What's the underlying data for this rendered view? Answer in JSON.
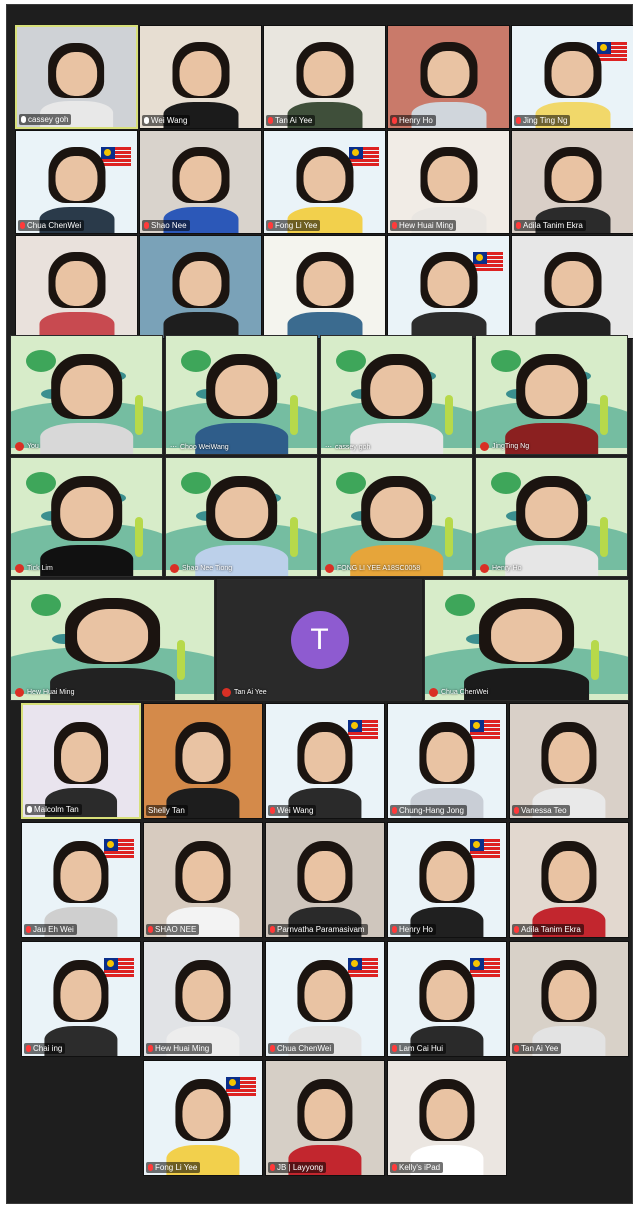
{
  "zoom_top": {
    "tiles": [
      {
        "name": "cassey goh",
        "active": true,
        "mic": "white",
        "bg": "#cfd2d6",
        "shirt": "#e8e8e8"
      },
      {
        "name": "Wei Wang",
        "active": false,
        "mic": "white",
        "bg": "#e7ded2",
        "shirt": "#1b1b1b"
      },
      {
        "name": "Tan Ai Yee",
        "active": false,
        "mic": "red",
        "bg": "#e9e6df",
        "shirt": "#3f4f3a"
      },
      {
        "name": "Henry Ho",
        "active": false,
        "mic": "red",
        "bg": "#c97a6a",
        "shirt": "#d0d6dc"
      },
      {
        "name": "Jing Ting Ng",
        "active": false,
        "mic": "red",
        "bg": "#eaf3f8",
        "shirt": "#f1d86a"
      },
      {
        "name": "Chua ChenWei",
        "active": false,
        "mic": "red",
        "bg": "#eaf3f8",
        "shirt": "#2a3a4a"
      },
      {
        "name": "Shao Nee",
        "active": false,
        "mic": "red",
        "bg": "#d9d3cc",
        "shirt": "#2c58b8"
      },
      {
        "name": "Fong Li Yee",
        "active": false,
        "mic": "red",
        "bg": "#eaf3f8",
        "shirt": "#f2d04c"
      },
      {
        "name": "Hew Huai Ming",
        "active": false,
        "mic": "red",
        "bg": "#f1ece6",
        "shirt": "#e9e6e2"
      },
      {
        "name": "Adila Tanim Ekra",
        "active": false,
        "mic": "red",
        "bg": "#d9cfc7",
        "shirt": "#2b2b2b"
      },
      {
        "name": "",
        "active": false,
        "mic": "",
        "bg": "#e9e1dc",
        "shirt": "#c84a50"
      },
      {
        "name": "",
        "active": false,
        "mic": "",
        "bg": "#7aa2b8",
        "shirt": "#1e1e1e"
      },
      {
        "name": "",
        "active": false,
        "mic": "",
        "bg": "#f4f4ee",
        "shirt": "#3b6b8f"
      },
      {
        "name": "",
        "active": false,
        "mic": "",
        "bg": "#eaf3f8",
        "shirt": "#2d2d2d"
      },
      {
        "name": "",
        "active": false,
        "mic": "",
        "bg": "#e7e7e7",
        "shirt": "#222222"
      }
    ]
  },
  "meet": {
    "tiles": [
      {
        "name": "You",
        "mic": "red",
        "shirt": "#d8d8d8"
      },
      {
        "name": "Choo WeiWang",
        "mic": "dots",
        "shirt": "#2f5d8a"
      },
      {
        "name": "cassey goh",
        "mic": "dots",
        "shirt": "#e7e7e7"
      },
      {
        "name": "JingTing Ng",
        "mic": "red",
        "shirt": "#8b2020"
      },
      {
        "name": "Tick Lim",
        "mic": "red",
        "shirt": "#111111"
      },
      {
        "name": "Shao Nee Tiong",
        "mic": "red",
        "shirt": "#bcd0ea"
      },
      {
        "name": "FONG LI YEE A18SC0058",
        "mic": "red",
        "shirt": "#e6a53a"
      },
      {
        "name": "Henry Ho",
        "mic": "red",
        "shirt": "#e6e6e6"
      },
      {
        "name": "Hew Huai Ming",
        "mic": "red",
        "shirt": "#222222"
      },
      {
        "name": "Tan Ai Yee",
        "mic": "red",
        "avatar_letter": "T",
        "avatar_color": "#8e5bd0"
      },
      {
        "name": "Chua ChenWei",
        "mic": "red",
        "shirt": "#1b1b1b"
      }
    ]
  },
  "zoom_bottom": {
    "tiles": [
      {
        "name": "Malcolm Tan",
        "active": true,
        "mic": "white",
        "bg": "#e9e4ee",
        "shirt": "#2b2b2b"
      },
      {
        "name": "Shelly Tan",
        "active": false,
        "mic": "",
        "bg": "#d48a4a",
        "shirt": "#1d1d1d"
      },
      {
        "name": "Wei Wang",
        "active": false,
        "mic": "red",
        "bg": "#eaf3f8",
        "shirt": "#2a2a2a"
      },
      {
        "name": "Chung-Hang Jong",
        "active": false,
        "mic": "red",
        "bg": "#eaf3f8",
        "shirt": "#c9ced6"
      },
      {
        "name": "Vanessa Teo",
        "active": false,
        "mic": "red",
        "bg": "#d9d0c8",
        "shirt": "#e9e9e9"
      },
      {
        "name": "Jau Eh Wei",
        "active": false,
        "mic": "red",
        "bg": "#eaf3f8",
        "shirt": "#cfcfcf"
      },
      {
        "name": "SHAO NEE",
        "active": false,
        "mic": "red",
        "bg": "#d7cbbf",
        "shirt": "#f3f3f3"
      },
      {
        "name": "Parnvatha Paramasivam",
        "active": false,
        "mic": "red",
        "bg": "#cfc6bd",
        "shirt": "#2a2a2a"
      },
      {
        "name": "Henry Ho",
        "active": false,
        "mic": "red",
        "bg": "#eaf3f8",
        "shirt": "#202020"
      },
      {
        "name": "Adila Tanim Ekra",
        "active": false,
        "mic": "red",
        "bg": "#e2d8cf",
        "shirt": "#c2262e"
      },
      {
        "name": "Chai ing",
        "active": false,
        "mic": "red",
        "bg": "#eaf3f8",
        "shirt": "#2c2c2c"
      },
      {
        "name": "Hew Huai Ming",
        "active": false,
        "mic": "red",
        "bg": "#e1e3e6",
        "shirt": "#ededed"
      },
      {
        "name": "Chua ChenWei",
        "active": false,
        "mic": "red",
        "bg": "#eaf3f8",
        "shirt": "#e4e4e4"
      },
      {
        "name": "Lam Cai Hui",
        "active": false,
        "mic": "red",
        "bg": "#eaf3f8",
        "shirt": "#2a2a2a"
      },
      {
        "name": "Tan Ai Yee",
        "active": false,
        "mic": "red",
        "bg": "#d8d1c8",
        "shirt": "#e3e3e3"
      },
      {
        "name": "Fong Li Yee",
        "active": false,
        "mic": "red",
        "bg": "#eaf3f8",
        "shirt": "#f2d04c"
      },
      {
        "name": "JB | Layyong",
        "active": false,
        "mic": "red",
        "bg": "#d6cfc6",
        "shirt": "#c2262e"
      },
      {
        "name": "Kelly's iPad",
        "active": false,
        "mic": "red",
        "bg": "#ebe6e1",
        "shirt": "#ffffff"
      }
    ]
  }
}
